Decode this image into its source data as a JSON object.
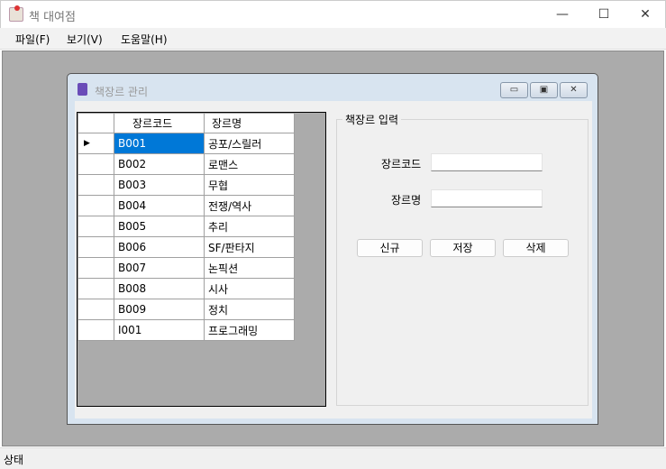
{
  "window": {
    "title": "책 대여점",
    "minimize": "—",
    "maximize": "☐",
    "close": "✕"
  },
  "menu": [
    "파일(F)",
    "보기(V)",
    "도움말(H)"
  ],
  "child": {
    "title": "책장르 관리",
    "minimize": "▭",
    "restore": "▣",
    "close": "✕"
  },
  "grid": {
    "columns": [
      "장르코드",
      "장르명"
    ],
    "rows": [
      [
        "B001",
        "공포/스릴러"
      ],
      [
        "B002",
        "로맨스"
      ],
      [
        "B003",
        "무협"
      ],
      [
        "B004",
        "전쟁/역사"
      ],
      [
        "B005",
        "추리"
      ],
      [
        "B006",
        "SF/판타지"
      ],
      [
        "B007",
        "논픽션"
      ],
      [
        "B008",
        "시사"
      ],
      [
        "B009",
        "정치"
      ],
      [
        "I001",
        "프로그래밍"
      ]
    ],
    "current_marker": "▶"
  },
  "form": {
    "group_title": "책장르 입력",
    "code_label": "장르코드",
    "name_label": "장르명",
    "code_value": "",
    "name_value": "",
    "buttons": {
      "new": "신규",
      "save": "저장",
      "delete": "삭제"
    }
  },
  "status": {
    "text": "상태"
  }
}
